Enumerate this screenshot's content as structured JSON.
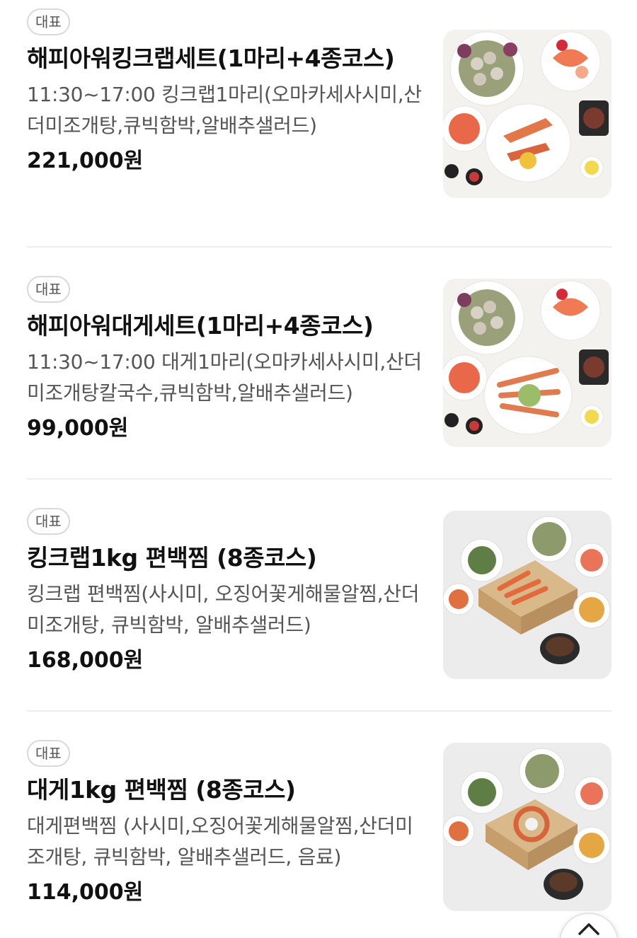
{
  "menu": {
    "items": [
      {
        "badge": "대표",
        "title": "해피아워킹크랩세트(1마리+4종코스)",
        "description": "11:30~17:00 킹크랩1마리(오마카세사시미,산더미조개탕,큐빅함박,알배추샐러드)",
        "price": "221,000원",
        "image_icon": "seafood-platter-image"
      },
      {
        "badge": "대표",
        "title": "해피아워대게세트(1마리+4종코스)",
        "description": "11:30~17:00 대게1마리(오마카세사시미,산더미조개탕칼국수,큐빅함박,알배추샐러드)",
        "price": "99,000원",
        "image_icon": "seafood-platter-image"
      },
      {
        "badge": "대표",
        "title": "킹크랩1kg 편백찜 (8종코스)",
        "description": "킹크랩 편백찜(사시미, 오징어꽃게해물알찜,산더미조개탕, 큐빅함박, 알배추샐러드)",
        "price": "168,000원",
        "image_icon": "steamer-box-image"
      },
      {
        "badge": "대표",
        "title": "대게1kg 편백찜 (8종코스)",
        "description": "대게편백찜 (사시미,오징어꽃게해물알찜,산더미조개탕, 큐빅함박, 알배추샐러드, 음료)",
        "price": "114,000원",
        "image_icon": "steamer-box-image"
      }
    ]
  },
  "scroll_top_icon": "arrow-up-icon"
}
